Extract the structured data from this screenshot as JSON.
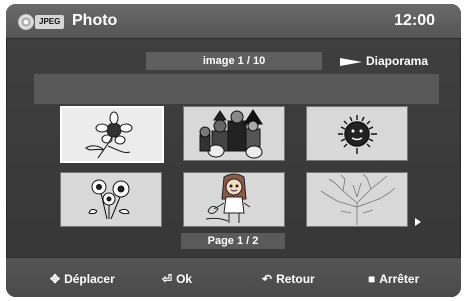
{
  "header": {
    "badge": "JPEG",
    "title": "Photo",
    "clock": "12:00"
  },
  "viewer": {
    "counter": "image 1 / 10",
    "slideshow_label": "Diaporama",
    "page": "Page 1 / 2"
  },
  "thumbnails": [
    {
      "icon": "flower-icon",
      "selected": true
    },
    {
      "icon": "halloween-kids-icon",
      "selected": false
    },
    {
      "icon": "sun-icon",
      "selected": false
    },
    {
      "icon": "flowers-bouquet-icon",
      "selected": false
    },
    {
      "icon": "girl-icon",
      "selected": false
    },
    {
      "icon": "tree-icon",
      "selected": false
    }
  ],
  "footer": {
    "move_label": "Déplacer",
    "ok_label": "Ok",
    "back_label": "Retour",
    "stop_label": "Arrêter"
  }
}
